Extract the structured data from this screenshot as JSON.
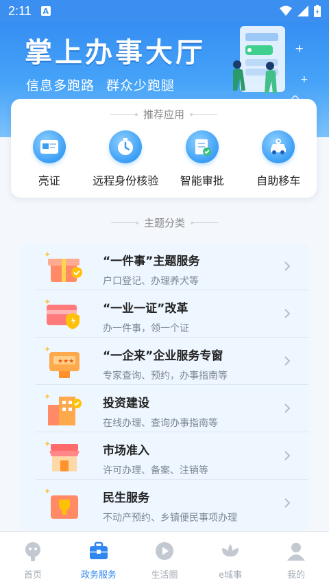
{
  "status_bar": {
    "time": "2:11",
    "notification_glyph": "A"
  },
  "banner": {
    "title": "掌上办事大厅",
    "subtitle": "信息多跑路  群众少跑腿"
  },
  "recommend": {
    "heading": "推荐应用",
    "items": [
      {
        "label": "亮证",
        "icon": "id-card-icon"
      },
      {
        "label": "远程身份核验",
        "icon": "stopwatch-icon"
      },
      {
        "label": "智能审批",
        "icon": "document-check-icon"
      },
      {
        "label": "自助移车",
        "icon": "car-icon"
      }
    ]
  },
  "themes": {
    "heading": "主题分类",
    "items": [
      {
        "title": "“一件事”主题服务",
        "desc": "户口登记、办理养犬等",
        "icon": "gift-box-icon"
      },
      {
        "title": "“一业一证”改革",
        "desc": "办一件事，领一个证",
        "icon": "card-shield-icon"
      },
      {
        "title": "“一企来”企业服务专窗",
        "desc": "专家查询、预约，办事指南等",
        "icon": "service-window-icon"
      },
      {
        "title": "投资建设",
        "desc": "在线办理、查询办事指南等",
        "icon": "building-icon"
      },
      {
        "title": "市场准入",
        "desc": "许可办理、备案、注销等",
        "icon": "storefront-icon"
      },
      {
        "title": "民生服务",
        "desc": "不动产预约、乡镇便民事项办理",
        "icon": "trophy-icon"
      }
    ]
  },
  "bottom_nav": {
    "items": [
      {
        "label": "首页",
        "icon": "home-face-icon",
        "active": false
      },
      {
        "label": "政务服务",
        "icon": "briefcase-icon",
        "active": true
      },
      {
        "label": "生活圈",
        "icon": "play-circle-icon",
        "active": false
      },
      {
        "label": "e城事",
        "icon": "lotus-icon",
        "active": false
      },
      {
        "label": "我的",
        "icon": "user-icon",
        "active": false
      }
    ]
  },
  "colors": {
    "primary": "#2f86f0",
    "inactive": "#a6adb6",
    "theme_card_bg": "#eef6ff"
  }
}
